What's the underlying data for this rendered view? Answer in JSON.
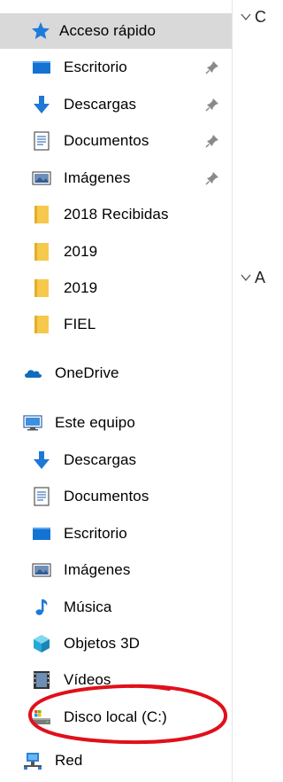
{
  "quick_access": {
    "label": "Acceso rápido",
    "items": [
      {
        "label": "Escritorio",
        "icon": "desktop-folder-icon",
        "pinned": true
      },
      {
        "label": "Descargas",
        "icon": "downloads-arrow-icon",
        "pinned": true
      },
      {
        "label": "Documentos",
        "icon": "documents-icon",
        "pinned": true
      },
      {
        "label": "Imágenes",
        "icon": "pictures-icon",
        "pinned": true
      },
      {
        "label": "2018 Recibidas",
        "icon": "folder-icon",
        "pinned": false
      },
      {
        "label": "2019",
        "icon": "folder-icon",
        "pinned": false
      },
      {
        "label": "2019",
        "icon": "folder-icon",
        "pinned": false
      },
      {
        "label": "FIEL",
        "icon": "folder-icon",
        "pinned": false
      }
    ]
  },
  "onedrive": {
    "label": "OneDrive",
    "icon": "onedrive-cloud-icon"
  },
  "this_pc": {
    "label": "Este equipo",
    "icon": "computer-icon",
    "items": [
      {
        "label": "Descargas",
        "icon": "downloads-arrow-icon"
      },
      {
        "label": "Documentos",
        "icon": "documents-icon"
      },
      {
        "label": "Escritorio",
        "icon": "desktop-folder-icon"
      },
      {
        "label": "Imágenes",
        "icon": "pictures-icon"
      },
      {
        "label": "Música",
        "icon": "music-note-icon"
      },
      {
        "label": "Objetos 3D",
        "icon": "3d-objects-icon"
      },
      {
        "label": "Vídeos",
        "icon": "videos-icon"
      },
      {
        "label": "Disco local (C:)",
        "icon": "local-disk-icon"
      }
    ]
  },
  "network": {
    "label": "Red",
    "icon": "network-icon"
  },
  "content_headers": [
    "C",
    "A"
  ],
  "colors": {
    "selection": "#d9d9d9",
    "annotation_circle": "#e0101a",
    "folder_yellow": "#f6c94c",
    "windows_blue": "#1e78d6"
  }
}
